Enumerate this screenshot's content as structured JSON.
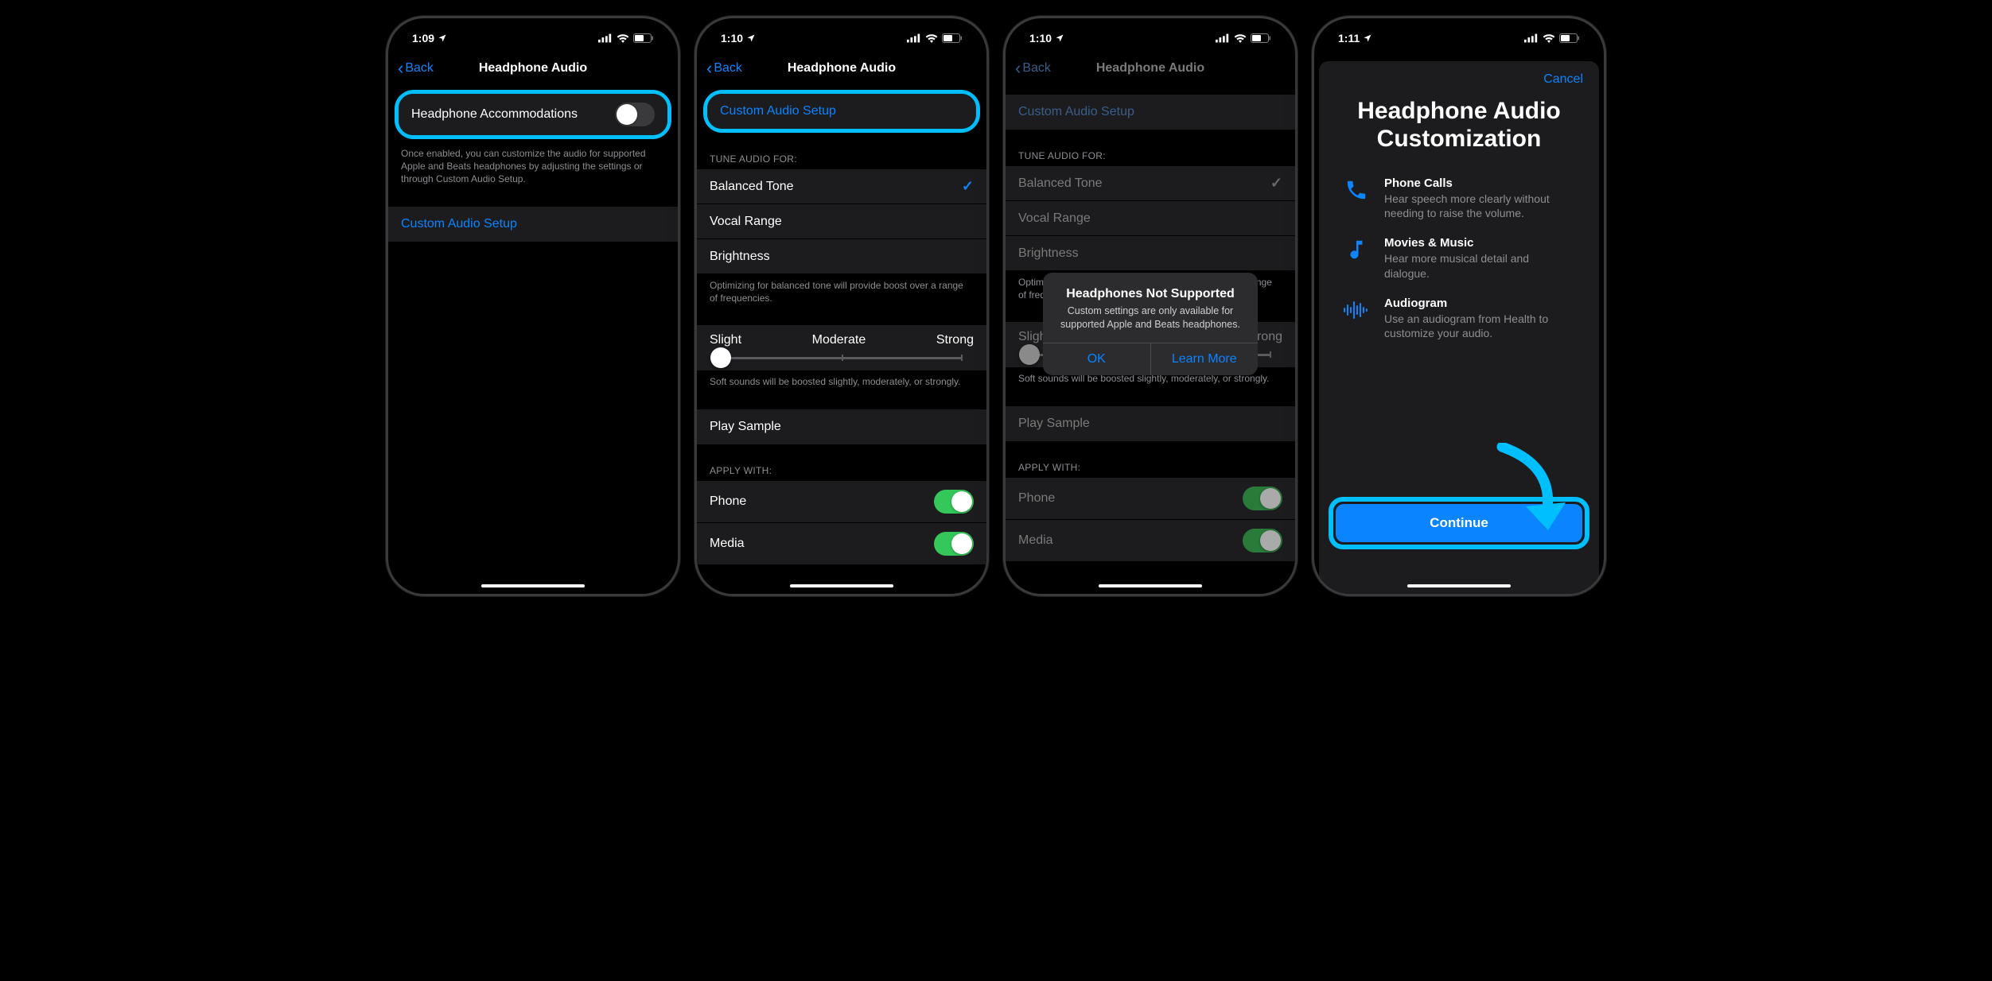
{
  "screen1": {
    "time": "1:09",
    "back": "Back",
    "title": "Headphone Audio",
    "accommodations": "Headphone Accommodations",
    "footer1": "Once enabled, you can customize the audio for supported Apple and Beats headphones by adjusting the settings or through Custom Audio Setup.",
    "custom_setup": "Custom Audio Setup"
  },
  "screen2": {
    "time": "1:10",
    "back": "Back",
    "title": "Headphone Audio",
    "custom_setup": "Custom Audio Setup",
    "tune_header": "TUNE AUDIO FOR:",
    "balanced": "Balanced Tone",
    "vocal": "Vocal Range",
    "brightness": "Brightness",
    "tune_footer": "Optimizing for balanced tone will provide boost over a range of frequencies.",
    "slight": "Slight",
    "moderate": "Moderate",
    "strong": "Strong",
    "boost_footer": "Soft sounds will be boosted slightly, moderately, or strongly.",
    "play_sample": "Play Sample",
    "apply_header": "APPLY WITH:",
    "phone": "Phone",
    "media": "Media"
  },
  "screen3": {
    "time": "1:10",
    "back": "Back",
    "title": "Headphone Audio",
    "alert_title": "Headphones Not Supported",
    "alert_msg": "Custom settings are only available for supported Apple and Beats headphones.",
    "ok": "OK",
    "learn_more": "Learn More"
  },
  "screen4": {
    "time": "1:11",
    "cancel": "Cancel",
    "title": "Headphone Audio Customization",
    "feat1_title": "Phone Calls",
    "feat1_desc": "Hear speech more clearly without needing to raise the volume.",
    "feat2_title": "Movies & Music",
    "feat2_desc": "Hear more musical detail and dialogue.",
    "feat3_title": "Audiogram",
    "feat3_desc": "Use an audiogram from Health to customize your audio.",
    "continue": "Continue"
  }
}
